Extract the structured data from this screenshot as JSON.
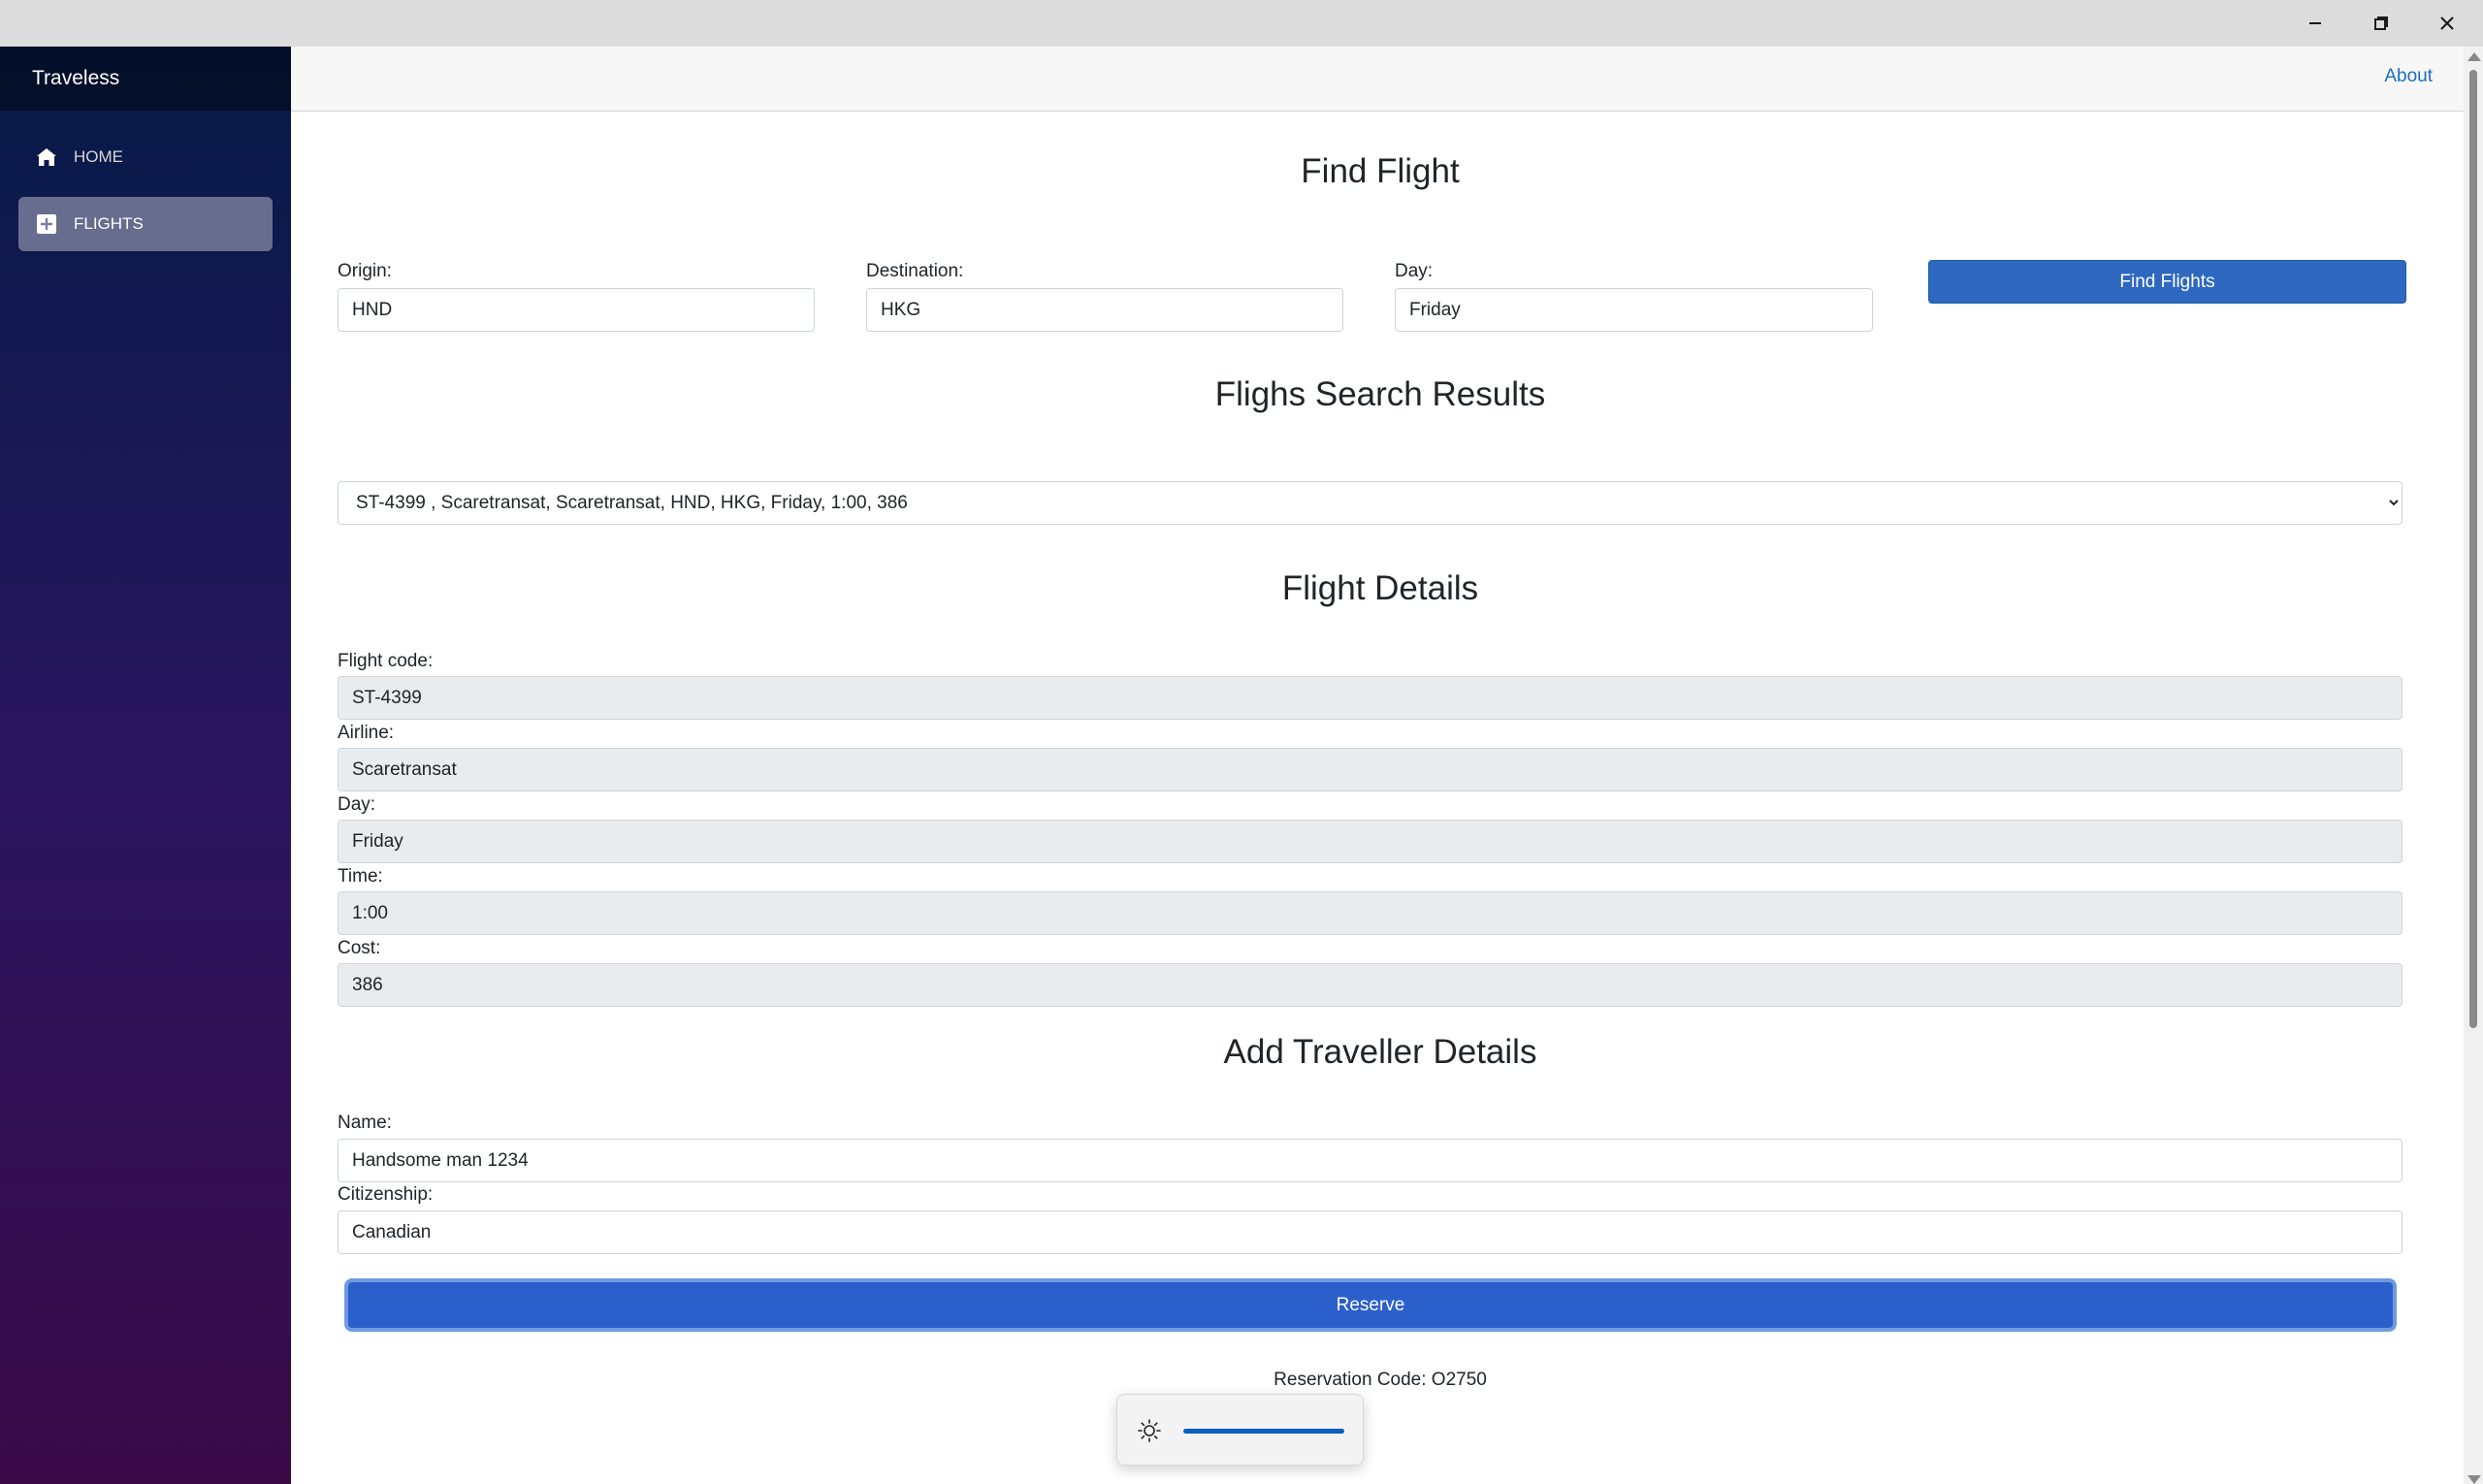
{
  "window": {
    "controls": [
      "minimize",
      "restore",
      "close"
    ]
  },
  "sidebar": {
    "brand": "Traveless",
    "items": [
      {
        "label": "HOME",
        "icon": "home-icon"
      },
      {
        "label": "FLIGHTS",
        "icon": "plus-square-icon",
        "active": true
      }
    ]
  },
  "header": {
    "about_label": "About"
  },
  "find_flight": {
    "title": "Find Flight",
    "origin_label": "Origin:",
    "origin_value": "HND",
    "destination_label": "Destination:",
    "destination_value": "HKG",
    "day_label": "Day:",
    "day_value": "Friday",
    "button_label": "Find Flights"
  },
  "search_results": {
    "title": "Flighs Search Results",
    "items": [
      "ST-4399 , Scaretransat, Scaretransat, HND, HKG, Friday, 1:00, 386"
    ]
  },
  "flight_details": {
    "title": "Flight Details",
    "fields": [
      {
        "label": "Flight code:",
        "value": "ST-4399"
      },
      {
        "label": "Airline:",
        "value": "Scaretransat"
      },
      {
        "label": "Day:",
        "value": "Friday"
      },
      {
        "label": "Time:",
        "value": "1:00"
      },
      {
        "label": "Cost:",
        "value": "386"
      }
    ]
  },
  "traveller": {
    "title": "Add Traveller Details",
    "name_label": "Name:",
    "name_value": "Handsome man 1234",
    "citizenship_label": "Citizenship:",
    "citizenship_value": "Canadian",
    "reserve_label": "Reserve",
    "reservation_code": "Reservation Code: O2750"
  },
  "brightness_flyout": {
    "icon": "brightness-icon",
    "level_percent": 100
  },
  "colors": {
    "primary": "#2e68c0",
    "reserve": "#2b5fcc",
    "link": "#1b6ec2"
  }
}
